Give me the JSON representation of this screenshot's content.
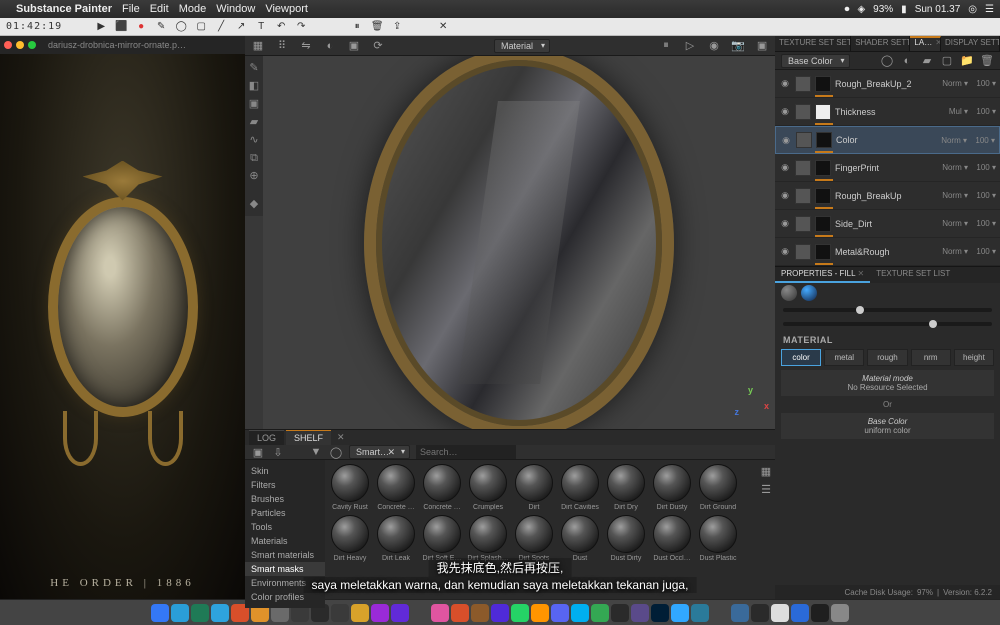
{
  "system": {
    "app_name": "Substance Painter",
    "menus": [
      "File",
      "Edit",
      "Mode",
      "Window",
      "Viewport"
    ],
    "timer": "01:42:19",
    "battery": "93%",
    "clock": "Sun 01.37"
  },
  "reference": {
    "tab": "dariusz-drobnica-mirror-ornate.p…",
    "caption": "HE ORDER | 1886"
  },
  "viewport": {
    "channel": "Material",
    "axes": {
      "x": "x",
      "y": "y",
      "z": "z"
    }
  },
  "top_panels": {
    "tabs": [
      "TEXTURE SET SETT…",
      "SHADER SETT…",
      "LA…",
      "DISPLAY SETT…"
    ],
    "active": 2,
    "channel_dd": "Base Color"
  },
  "layers": [
    {
      "name": "Rough_BreakUp_2",
      "blend": "Norm",
      "opac": "100",
      "mask": "black"
    },
    {
      "name": "Thickness",
      "blend": "Mul",
      "opac": "100",
      "mask": "white"
    },
    {
      "name": "Color",
      "blend": "Norm",
      "opac": "100",
      "mask": "black",
      "selected": true
    },
    {
      "name": "FingerPrint",
      "blend": "Norm",
      "opac": "100",
      "mask": "black"
    },
    {
      "name": "Rough_BreakUp",
      "blend": "Norm",
      "opac": "100",
      "mask": "black"
    },
    {
      "name": "Side_Dirt",
      "blend": "Norm",
      "opac": "100",
      "mask": "black"
    },
    {
      "name": "Metal&Rough",
      "blend": "Norm",
      "opac": "100",
      "mask": "black"
    }
  ],
  "properties": {
    "tabs": [
      "PROPERTIES - FILL",
      "TEXTURE SET LIST"
    ],
    "active": 0,
    "section": "MATERIAL",
    "channels": [
      "color",
      "metal",
      "rough",
      "nrm",
      "height"
    ],
    "active_channel": 0,
    "mode_label": "Material mode",
    "mode_value": "No Resource Selected",
    "or": "Or",
    "base_label": "Base Color",
    "base_value": "uniform color"
  },
  "shelf": {
    "tabs_log": "LOG",
    "tabs_shelf": "SHELF",
    "filter_chip": "Smart…",
    "search_ph": "Search…",
    "categories": [
      "Skin",
      "Filters",
      "Brushes",
      "Particles",
      "Tools",
      "Materials",
      "Smart materials",
      "Smart masks",
      "Environments",
      "Color profiles"
    ],
    "selected_cat": 7,
    "assets_row1": [
      "Cavity Rust",
      "Concrete …",
      "Concrete …",
      "Crumples",
      "Dirt",
      "Dirt Cavities",
      "Dirt Dry",
      "Dirt Dusty",
      "Dirt Ground"
    ],
    "assets_row2": [
      "Dirt Heavy",
      "Dirt Leak",
      "Dirt Soft E…",
      "Dirt Splash…",
      "Dirt Spots",
      "Dust",
      "Dust Dirty",
      "Dust Occl…",
      "Dust Plastic"
    ]
  },
  "status": {
    "disk": "Cache Disk Usage:",
    "disk_val": "97%",
    "version": "Version: 6.2.2"
  },
  "subtitles": {
    "line1": "我先抹底色,然后再按压,",
    "line2": "saya meletakkan warna, dan kemudian saya meletakkan tekanan juga,"
  },
  "dock_colors": [
    "#3478f6",
    "#2a9ed8",
    "#1f7a56",
    "#2ea3dd",
    "#d94f2a",
    "#e0922a",
    "#6a6a6a",
    "#3a3a3a",
    "#2a2a2a",
    "#3a3a3a",
    "#d9a22a",
    "#9a2ad9",
    "#612ad9",
    "#444",
    "#e055a0",
    "#d94f2a",
    "#8c5a2a",
    "#4f2ad9",
    "#25d366",
    "#ff9500",
    "#5865f2",
    "#00aff0",
    "#34a853",
    "#2a2a2a",
    "#5a4a8a",
    "#001e36",
    "#31a8ff",
    "#2a7a9a",
    "#444",
    "#3a6a9a",
    "#2a2a2a",
    "#ddd",
    "#2a6ad9",
    "#1f1f1f",
    "#888"
  ]
}
